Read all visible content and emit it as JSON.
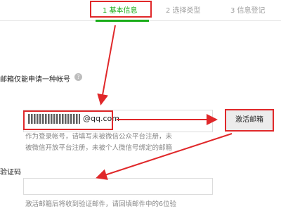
{
  "steps": [
    {
      "label": "1 基本信息",
      "state": "active"
    },
    {
      "label": "2 选择类型",
      "state": "inactive"
    },
    {
      "label": "3 信息登记",
      "state": "inactive"
    }
  ],
  "email_section": {
    "label_text": "邮箱仅能申请一种帐号",
    "help_icon": "?",
    "input_value": "@qq.com",
    "hint_line1": "作为登录帐号，请填写未被微信公众平台注册，未",
    "hint_line2": "被微信开放平台注册，未被个人微信号绑定的邮箱",
    "activate_button_label": "激活邮箱"
  },
  "code_section": {
    "label_text": "验证码",
    "input_value": "",
    "hint_line1": "激活邮箱后将收到验证邮件，请回填邮件中的6位验"
  },
  "colors": {
    "accent_green": "#1aad19",
    "highlight_red": "#e0282a"
  }
}
